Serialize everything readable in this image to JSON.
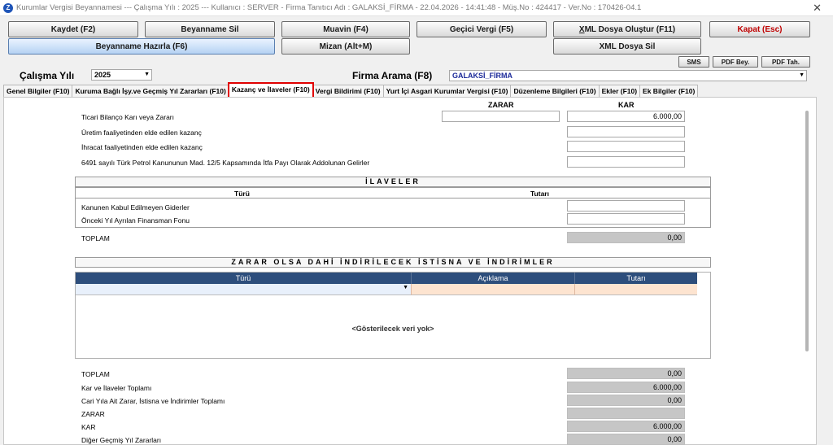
{
  "window": {
    "title": "Kurumlar Vergisi Beyannamesi  ---  Çalışma Yılı : 2025  ---  Kullanıcı : SERVER - Firma Tanıtıcı Adı : GALAKSİ_FİRMA - 22.04.2026 - 14:41:48 - Müş.No : 424417 - Ver.No : 170426-04.1",
    "close": "✕"
  },
  "toolbar": {
    "save": "Kaydet (F2)",
    "delete": "Beyanname Sil",
    "muavin": "Muavin (F4)",
    "temp_tax": "Geçici Vergi (F5)",
    "xml_create": "XML Dosya Oluştur (F11)",
    "close": "Kapat (Esc)",
    "prepare": "Beyanname Hazırla (F6)",
    "mizan": "Mizan (Alt+M)",
    "xml_delete": "XML Dosya Sil",
    "sms": "SMS",
    "pdf_bey": "PDF Bey.",
    "pdf_tah": "PDF Tah."
  },
  "filters": {
    "year_label": "Çalışma Yılı",
    "year_value": "2025",
    "firm_label": "Firma Arama (F8)",
    "firm_value": "GALAKSİ_FİRMA"
  },
  "tabs": [
    {
      "label": "Genel Bilgiler (F10)",
      "active": false
    },
    {
      "label": "Kuruma Bağlı İşy.ve Geçmiş Yıl Zararları (F10)",
      "active": false
    },
    {
      "label": "Kazanç ve İlaveler (F10)",
      "active": true
    },
    {
      "label": "Vergi Bildirimi (F10)",
      "active": false
    },
    {
      "label": "Yurt İçi Asgari Kurumlar Vergisi (F10)",
      "active": false
    },
    {
      "label": "Düzenleme Bilgileri (F10)",
      "active": false
    },
    {
      "label": "Ekler (F10)",
      "active": false
    },
    {
      "label": "Ek Bilgiler (F10)",
      "active": false
    }
  ],
  "kazanc": {
    "col_zarar": "ZARAR",
    "col_kar": "KAR",
    "rows": [
      {
        "label": "Ticari Bilanço Karı veya Zararı",
        "zarar": "",
        "kar": "6.000,00"
      },
      {
        "label": "Üretim faaliyetinden elde edilen kazanç",
        "kar": ""
      },
      {
        "label": "İhracat faaliyetinden elde edilen kazanç",
        "kar": ""
      },
      {
        "label": "6491 sayılı Türk Petrol Kanununun Mad. 12/5 Kapsamında İtfa Payı Olarak Addolunan Gelirler",
        "kar": ""
      }
    ]
  },
  "ilaveler": {
    "title": "İLAVELER",
    "col_type": "Türü",
    "col_amount": "Tutarı",
    "rows": [
      {
        "label": "Kanunen Kabul Edilmeyen Giderler",
        "value": ""
      },
      {
        "label": "Önceki Yıl Ayrılan Finansman Fonu",
        "value": ""
      }
    ],
    "total_label": "TOPLAM",
    "total_value": "0,00"
  },
  "indirimler": {
    "title": "ZARAR OLSA DAHİ İNDİRİLECEK İSTİSNA VE İNDİRİMLER",
    "grid_headers": [
      "Türü",
      "Açıklama",
      "Tutarı"
    ],
    "empty_text": "<Gösterilecek veri yok>"
  },
  "summary": [
    {
      "label": "TOPLAM",
      "value": "0,00"
    },
    {
      "label": "Kar ve İlaveler Toplamı",
      "value": "6.000,00"
    },
    {
      "label": "Cari Yıla Ait Zarar, İstisna ve İndirimler Toplamı",
      "value": "0,00"
    },
    {
      "label": "ZARAR",
      "value": ""
    },
    {
      "label": "KAR",
      "value": "6.000,00"
    },
    {
      "label": "Diğer Geçmiş Yıl Zararları",
      "value": "0,00"
    }
  ]
}
